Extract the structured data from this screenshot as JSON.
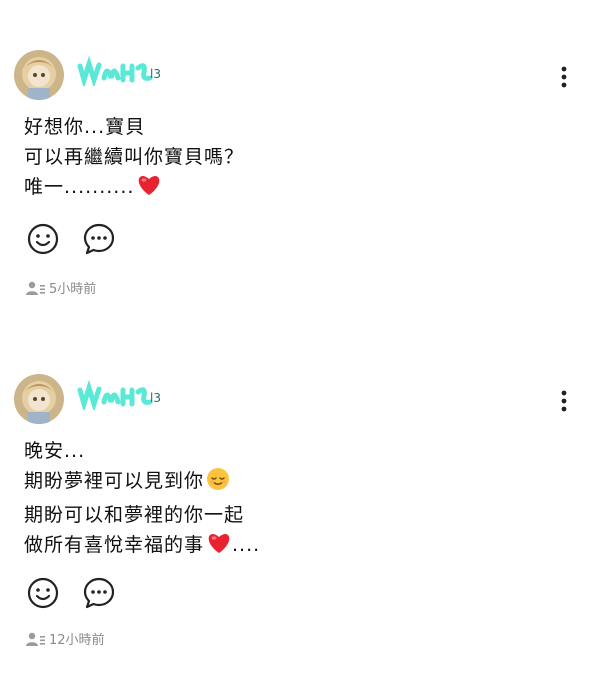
{
  "posts": [
    {
      "text_lines": [
        "好想你...寶貝",
        "可以再繼續叫你寶貝嗎？",
        "唯一.........."
      ],
      "timestamp": "5小時前",
      "emojis": [
        "heart"
      ]
    },
    {
      "text_lines": [
        "晚安...",
        "期盼夢裡可以見到你",
        "期盼可以和夢裡的你一起",
        "做所有喜悅幸福的事"
      ],
      "trailing": "....",
      "timestamp": "12小時前",
      "emojis": [
        "relieved-face",
        "heart"
      ]
    }
  ],
  "colors": {
    "username_highlight": "#3ee6d0",
    "heart": "#e8232f",
    "meta_text": "#8a8a8a",
    "icon_stroke": "#222222"
  },
  "icons": [
    "more-vertical-icon",
    "smile-icon",
    "comment-icon",
    "viewers-icon"
  ]
}
